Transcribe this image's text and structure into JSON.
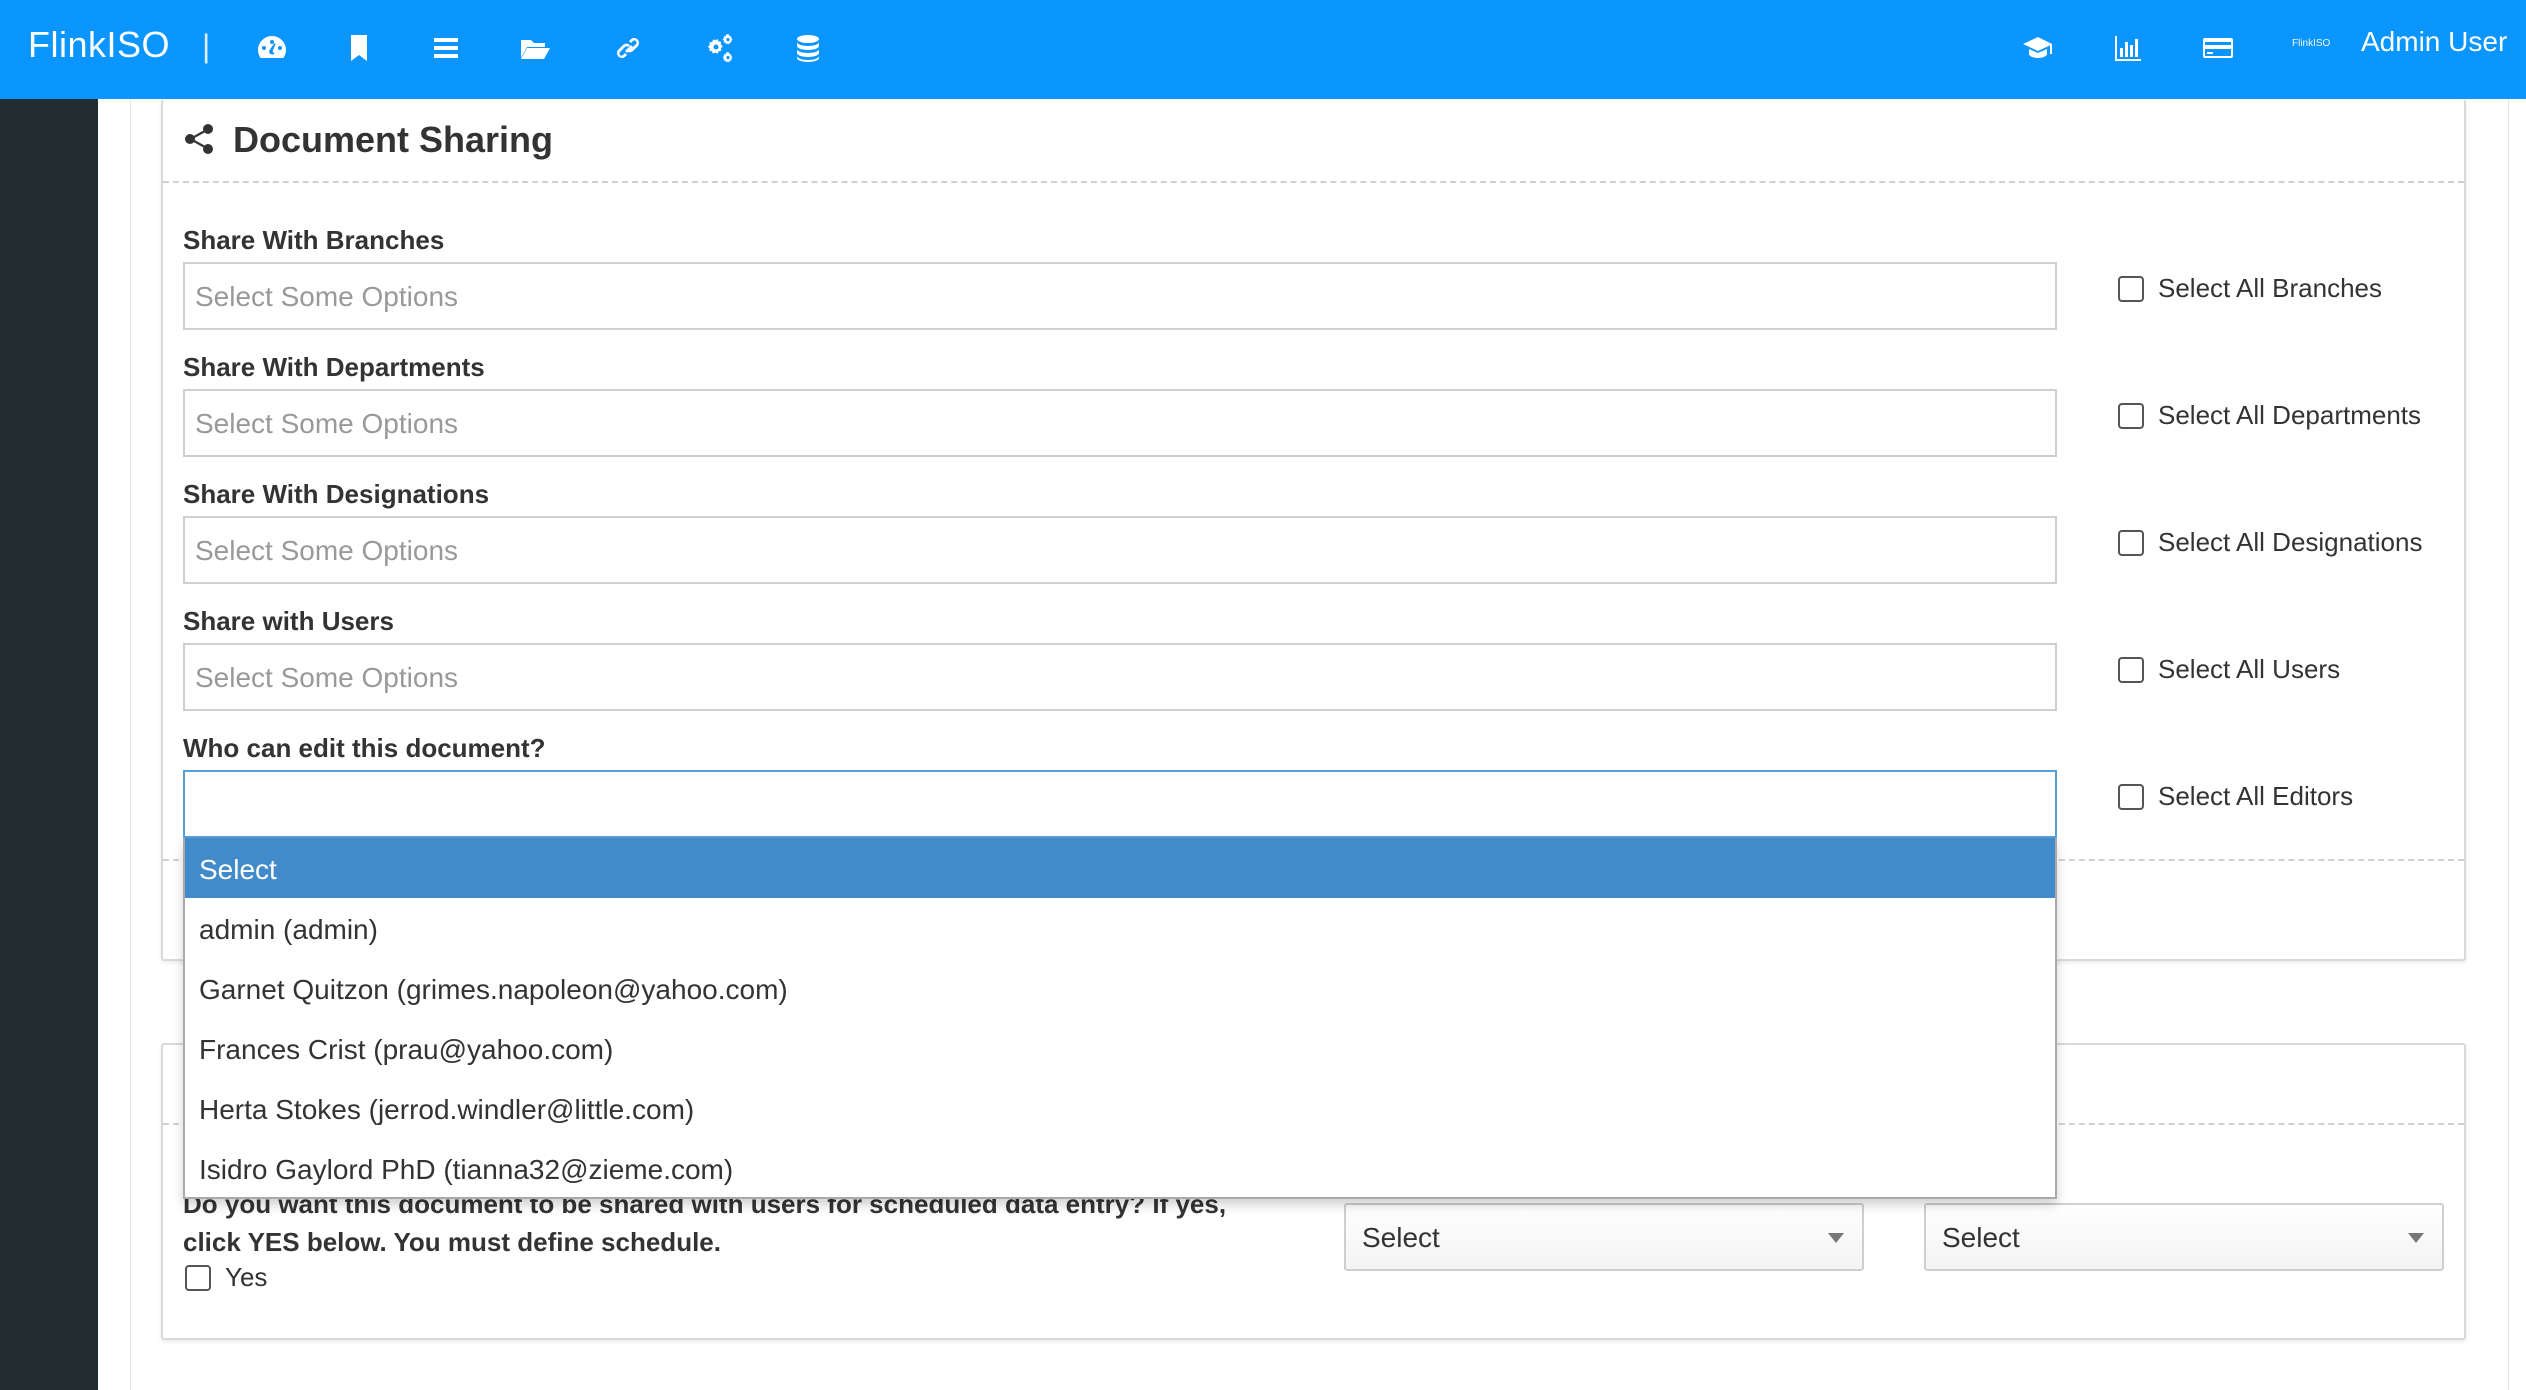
{
  "app": {
    "brand": "FlinkISO",
    "separator": "|",
    "tiny_logo": "FlinkISO",
    "user_name": "Admin User"
  },
  "nav_icons": [
    "dashboard-icon",
    "bookmark-icon",
    "list-icon",
    "folder-open-icon",
    "link-icon",
    "cogs-icon",
    "database-icon"
  ],
  "right_icons": [
    "graduation-cap-icon",
    "bar-chart-icon",
    "credit-card-icon"
  ],
  "panel": {
    "title": "Document Sharing",
    "icon": "share-icon"
  },
  "fields": {
    "branches": {
      "label": "Share With Branches",
      "placeholder": "Select Some Options",
      "select_all": "Select All Branches"
    },
    "departments": {
      "label": "Share With Departments",
      "placeholder": "Select Some Options",
      "select_all": "Select All Departments"
    },
    "designations": {
      "label": "Share With Designations",
      "placeholder": "Select Some Options",
      "select_all": "Select All Designations"
    },
    "users": {
      "label": "Share with Users",
      "placeholder": "Select Some Options",
      "select_all": "Select All Users"
    },
    "editors": {
      "label": "Who can edit this document?",
      "value": "",
      "select_all": "Select All Editors"
    }
  },
  "editor_options": [
    "Select",
    "admin (admin)",
    "Garnet Quitzon (grimes.napoleon@yahoo.com)",
    "Frances Crist (prau@yahoo.com)",
    "Herta Stokes (jerrod.windler@little.com)",
    "Isidro Gaylord PhD (tianna32@zieme.com)"
  ],
  "schedule": {
    "question": "Do you want this document to be shared with users for scheduled data entry? If yes, click YES below. You must define schedule.",
    "yes_label": "Yes",
    "select1": "Select",
    "select2": "Select"
  },
  "colors": {
    "topbar": "#0a95ff",
    "sidebar": "#222d32",
    "selected_option": "#418bca"
  }
}
